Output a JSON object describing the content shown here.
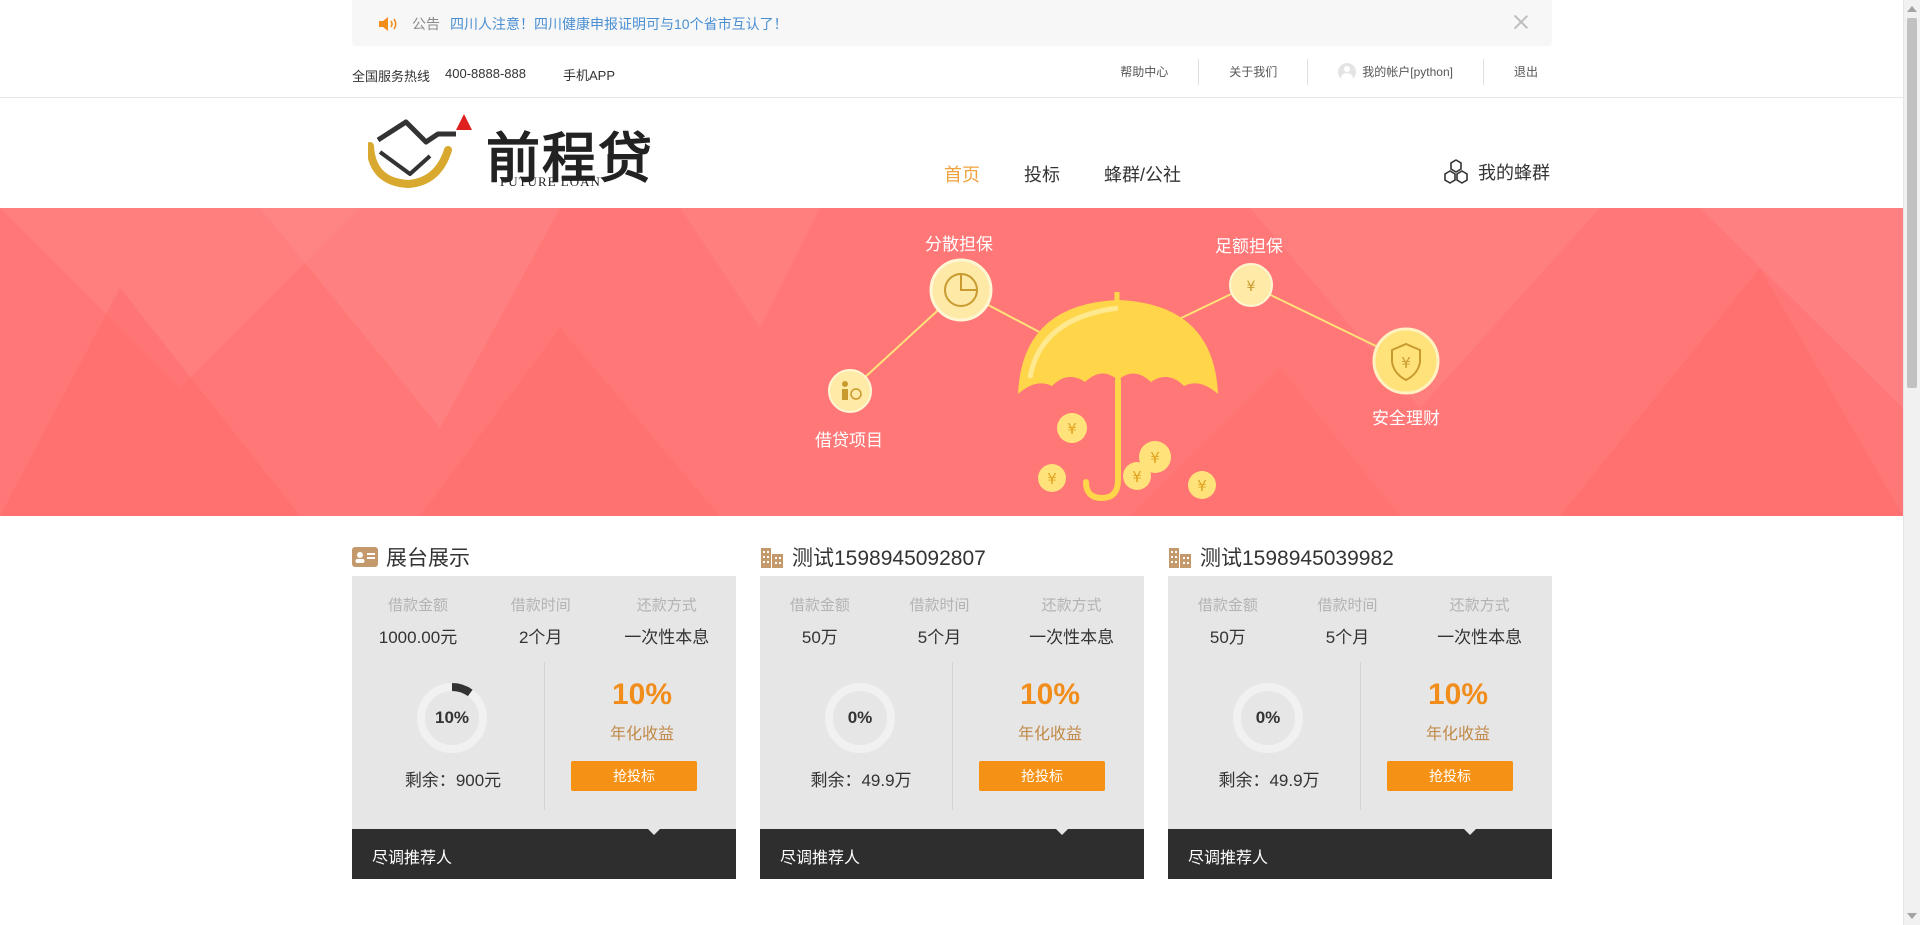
{
  "notice": {
    "label": "公告",
    "text": "四川人注意！四川健康申报证明可与10个省市互认了！"
  },
  "topbar": {
    "hotline_label": "全国服务热线",
    "hotline_number": "400-8888-888",
    "mobile_app": "手机APP",
    "links": {
      "help": "帮助中心",
      "about": "关于我们",
      "account": "我的帐户[python]",
      "logout": "退出"
    }
  },
  "header": {
    "logo_cn": "前程贷",
    "logo_en": "FUTURE LOAN",
    "nav": {
      "home": "首页",
      "invest": "投标",
      "community": "蜂群/公社"
    },
    "my_hive": "我的蜂群"
  },
  "banner": {
    "labels": {
      "diversified": "分散担保",
      "full": "足额担保",
      "projects": "借贷项目",
      "safe": "安全理财"
    },
    "colors": {
      "background": "#ff7777",
      "accent": "#ffe27a"
    }
  },
  "common": {
    "amount_label": "借款金额",
    "term_label": "借款时间",
    "repay_label": "还款方式",
    "rate_label": "年化收益",
    "bid_button": "抢投标",
    "footer": "尽调推荐人",
    "remain_prefix": "剩余："
  },
  "cards": [
    {
      "title": "展台展示",
      "amount": "1000.00元",
      "term": "2个月",
      "repay": "一次性本息",
      "progress_text": "10%",
      "progress": 0.1,
      "rate": "10%",
      "remain": "900元"
    },
    {
      "title": "测试1598945092807",
      "amount": "50万",
      "term": "5个月",
      "repay": "一次性本息",
      "progress_text": "0%",
      "progress": 0,
      "rate": "10%",
      "remain": "49.9万"
    },
    {
      "title": "测试1598945039982",
      "amount": "50万",
      "term": "5个月",
      "repay": "一次性本息",
      "progress_text": "0%",
      "progress": 0,
      "rate": "10%",
      "remain": "49.9万"
    }
  ],
  "colors": {
    "accent_orange": "#f59114",
    "nav_active": "#f0a23d",
    "notice_link": "#4a8fd3",
    "footer_dark": "#2e2e2e"
  }
}
